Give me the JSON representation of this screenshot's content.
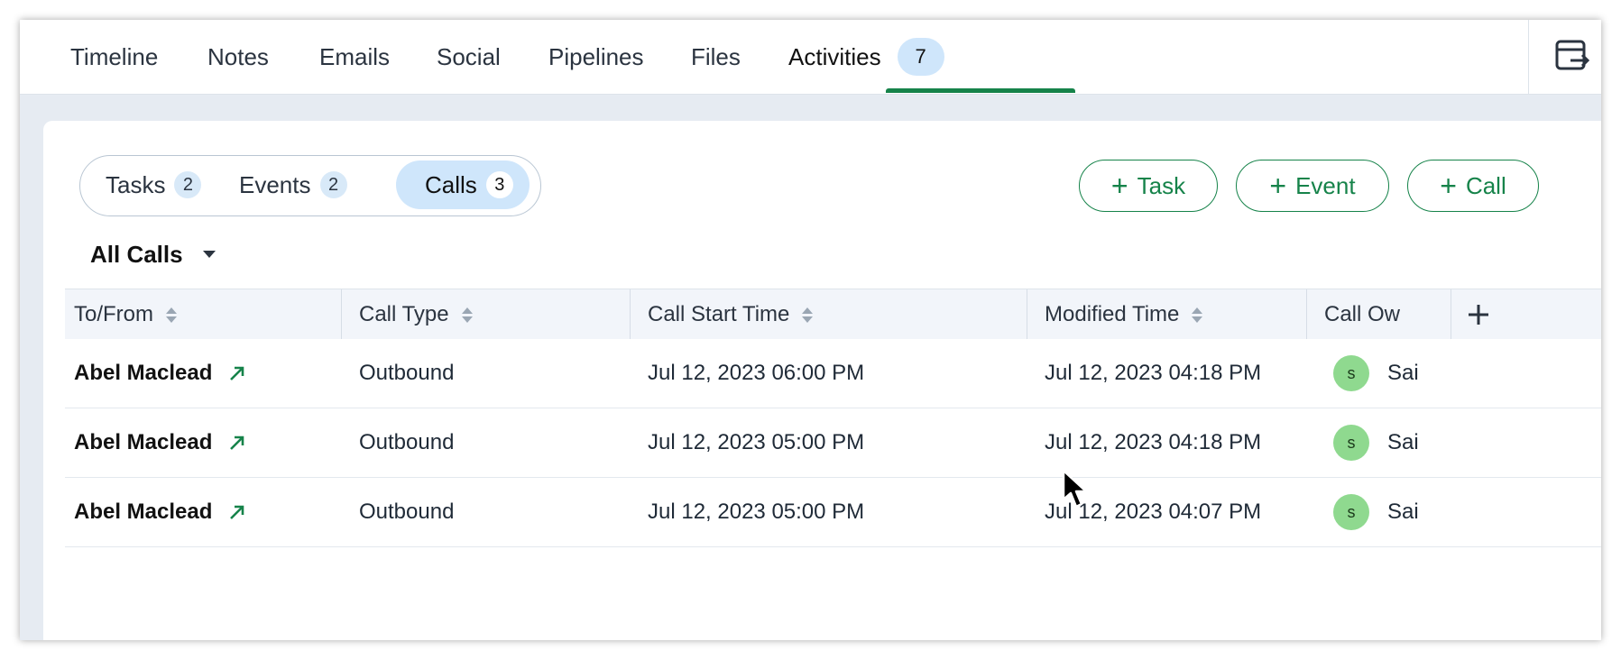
{
  "tabs": [
    {
      "label": "Timeline"
    },
    {
      "label": "Notes"
    },
    {
      "label": "Emails"
    },
    {
      "label": "Social"
    },
    {
      "label": "Pipelines"
    },
    {
      "label": "Files"
    },
    {
      "label": "Activities",
      "count": "7",
      "active": true
    }
  ],
  "segments": [
    {
      "label": "Tasks",
      "count": "2"
    },
    {
      "label": "Events",
      "count": "2"
    },
    {
      "label": "Calls",
      "count": "3",
      "active": true
    }
  ],
  "actions": {
    "task": "Task",
    "event": "Event",
    "call": "Call"
  },
  "filter": {
    "label": "All Calls"
  },
  "table": {
    "columns": [
      "To/From",
      "Call Type",
      "Call Start Time",
      "Modified Time",
      "Call Ow"
    ],
    "rows": [
      {
        "to_from": "Abel Maclead",
        "call_type": "Outbound",
        "start": "Jul 12, 2023 06:00 PM",
        "modified": "Jul 12, 2023 04:18 PM",
        "owner_initial": "s",
        "owner": "Sai"
      },
      {
        "to_from": "Abel Maclead",
        "call_type": "Outbound",
        "start": "Jul 12, 2023 05:00 PM",
        "modified": "Jul 12, 2023 04:18 PM",
        "owner_initial": "s",
        "owner": "Sai"
      },
      {
        "to_from": "Abel Maclead",
        "call_type": "Outbound",
        "start": "Jul 12, 2023 05:00 PM",
        "modified": "Jul 12, 2023 04:07 PM",
        "owner_initial": "s",
        "owner": "Sai"
      }
    ]
  },
  "icons": {
    "export": "export-icon",
    "add_column": "plus-icon",
    "sort": "sort-icon",
    "outgoing": "outgoing-arrow-icon",
    "dropdown": "caret-down-icon"
  },
  "colors": {
    "accent": "#16834a",
    "pill": "#cfe6fb",
    "avatar": "#8fd98f",
    "background": "#e6ebf2"
  }
}
